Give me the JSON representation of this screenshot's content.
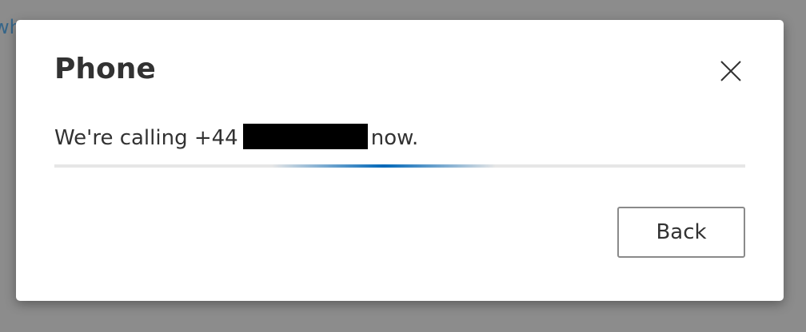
{
  "background": {
    "partial_link_text": "wh"
  },
  "dialog": {
    "title": "Phone",
    "close_icon": "close-icon",
    "message_prefix": "We're calling +44",
    "message_suffix": "now.",
    "redacted_number": true,
    "progress": {
      "state": "indeterminate",
      "accent_color": "#0067b8"
    },
    "back_label": "Back"
  }
}
